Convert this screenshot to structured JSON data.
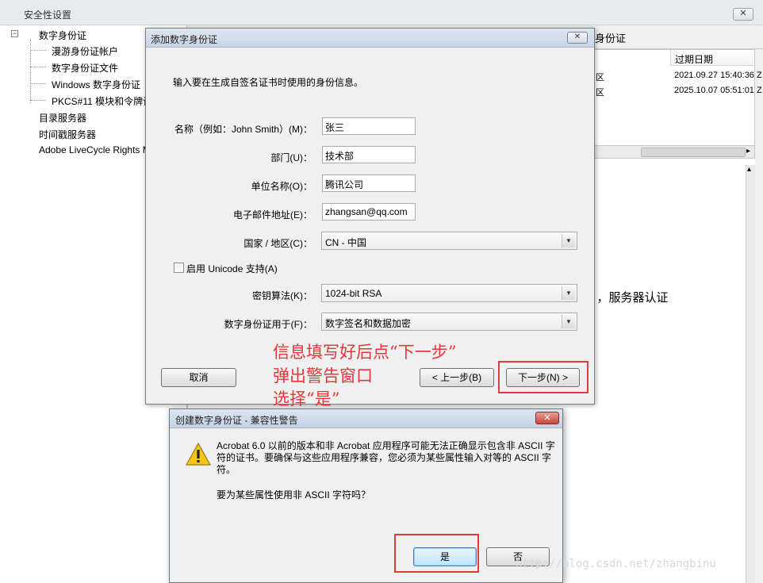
{
  "window": {
    "title": "安全性设置",
    "close_glyph": "✕"
  },
  "tree": {
    "toggle": "−",
    "items": [
      {
        "label": "数字身份证"
      },
      {
        "label": "漫游身份证帐户"
      },
      {
        "label": "数字身份证文件"
      },
      {
        "label": "Windows 数字身份证"
      },
      {
        "label": "PKCS#11 模块和令牌设"
      },
      {
        "label": "目录服务器"
      },
      {
        "label": "时间戳服务器"
      },
      {
        "label": "Adobe LiveCycle Rights M"
      }
    ]
  },
  "right_panel": {
    "header_title": "身份证",
    "column_header": "过期日期",
    "rows": [
      {
        "prefix": "区",
        "expiry": "2021.09.27 15:40:36 Z"
      },
      {
        "prefix": "区",
        "expiry": "2025.10.07 05:51:01 Z"
      }
    ],
    "scroll_right": "▸",
    "scroll_up": "▴",
    "detail_text": "），服务器认证"
  },
  "add_id_dialog": {
    "title": "添加数字身份证",
    "close_glyph": "✕",
    "intro": "输入要在生成自签名证书时使用的身份信息。",
    "fields": {
      "name": {
        "label": "名称（例如：John Smith）(M)：",
        "value": "张三"
      },
      "department": {
        "label": "部门(U)：",
        "value": "技术部"
      },
      "organization": {
        "label": "单位名称(O)：",
        "value": "腾讯公司"
      },
      "email": {
        "label": "电子邮件地址(E)：",
        "value": "zhangsan@qq.com"
      },
      "country": {
        "label": "国家 / 地区(C)：",
        "value": "CN - 中国"
      },
      "algorithm": {
        "label": "密钥算法(K)：",
        "value": "1024-bit RSA"
      },
      "usage": {
        "label": "数字身份证用于(F)：",
        "value": "数字签名和数据加密"
      }
    },
    "unicode_checkbox": {
      "label": "启用 Unicode 支持(A)",
      "checked": false
    },
    "buttons": {
      "cancel": "取消",
      "back": "< 上一步(B)",
      "next": "下一步(N) >"
    },
    "dropdown_arrow": "▼"
  },
  "annotation": {
    "lines": [
      "信息填写好后点“下一步”",
      "弹出警告窗口",
      "选择“是”"
    ],
    "color": "#e8363a"
  },
  "warning_dialog": {
    "title": "创建数字身份证 - 兼容性警告",
    "close_glyph": "✕",
    "message": "Acrobat 6.0 以前的版本和非 Acrobat 应用程序可能无法正确显示包含非 ASCII 字符的证书。要确保与这些应用程序兼容，您必须为某些属性输入对等的 ASCII 字符。",
    "question": "要为某些属性使用非 ASCII 字符吗？",
    "buttons": {
      "yes": "是",
      "no": "否"
    },
    "icon": "warning-icon"
  },
  "watermark": "http://blog.csdn.net/zhangbinu"
}
